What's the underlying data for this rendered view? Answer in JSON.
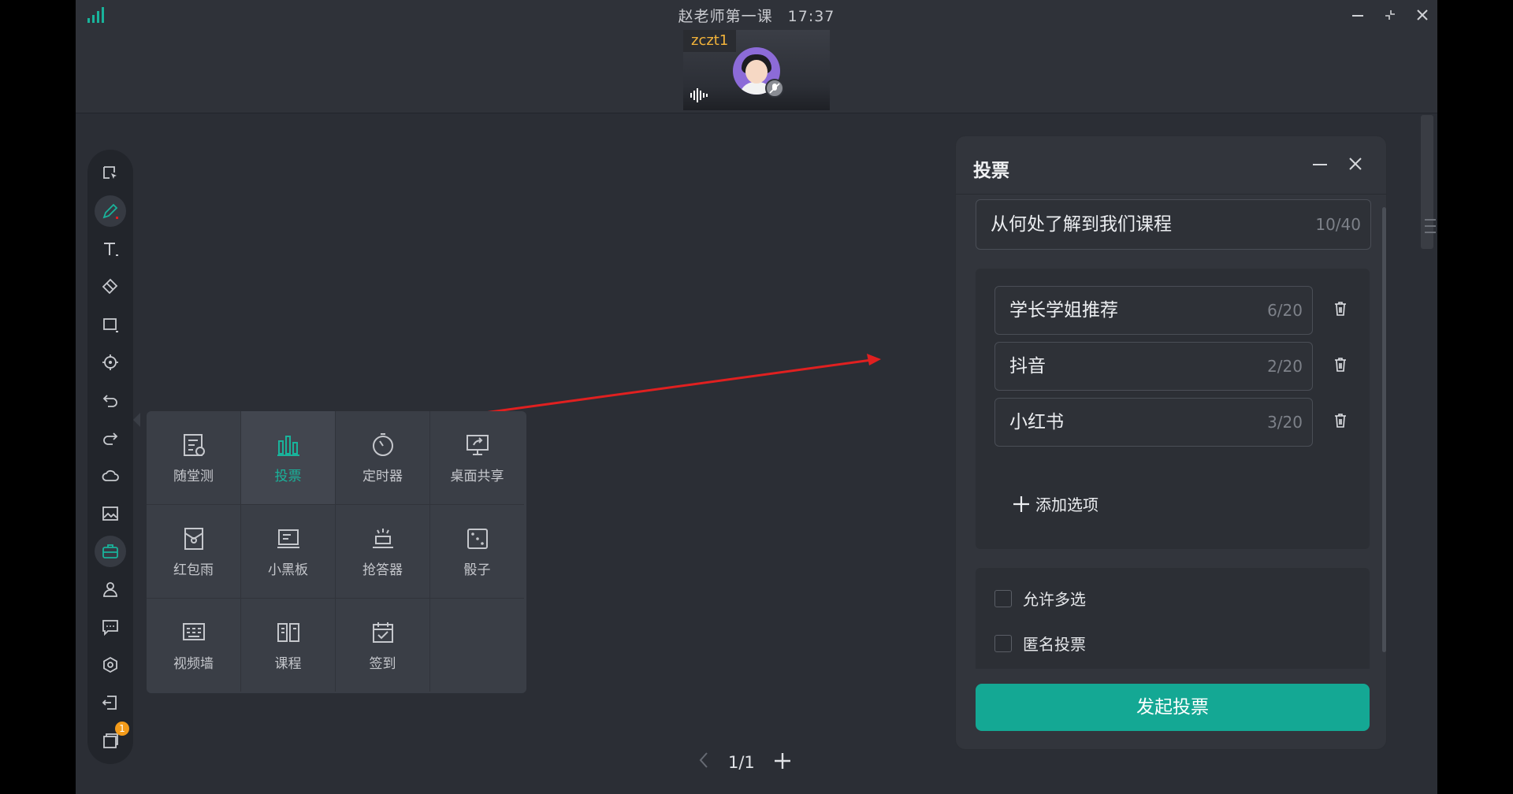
{
  "window": {
    "title": "赵老师第一课",
    "time": "17:37"
  },
  "video_tile": {
    "user_name": "zczt1"
  },
  "colors": {
    "accent": "#14a894",
    "selected_tool": "#19b39b",
    "name_label": "#f2b33a",
    "badge": "#f39b1a",
    "arrow": "#e02020"
  },
  "toolbar": {
    "icons": [
      "select-icon",
      "pen-icon",
      "text-icon",
      "eraser-icon",
      "shape-icon",
      "laser-pointer-icon",
      "undo-icon",
      "redo-icon",
      "cloud-icon",
      "image-icon",
      "toolbox-icon",
      "user-icon",
      "chat-icon",
      "settings-icon",
      "exit-icon",
      "layers-icon"
    ],
    "active": "toolbox-icon",
    "layers_badge": "1"
  },
  "tools_popup": {
    "items": [
      {
        "label": "随堂测",
        "icon": "quiz-icon"
      },
      {
        "label": "投票",
        "icon": "vote-icon",
        "selected": true
      },
      {
        "label": "定时器",
        "icon": "timer-icon"
      },
      {
        "label": "桌面共享",
        "icon": "screen-share-icon"
      },
      {
        "label": "红包雨",
        "icon": "red-packet-icon"
      },
      {
        "label": "小黑板",
        "icon": "blackboard-icon"
      },
      {
        "label": "抢答器",
        "icon": "buzzer-icon"
      },
      {
        "label": "骰子",
        "icon": "dice-icon"
      },
      {
        "label": "视频墙",
        "icon": "video-wall-icon"
      },
      {
        "label": "课程",
        "icon": "course-icon"
      },
      {
        "label": "签到",
        "icon": "check-in-icon"
      }
    ]
  },
  "pager": {
    "page": "1/1"
  },
  "vote_panel": {
    "title": "投票",
    "question": {
      "value": "从何处了解到我们课程",
      "counter": "10/40"
    },
    "options": [
      {
        "value": "学长学姐推荐",
        "counter": "6/20"
      },
      {
        "value": "抖音",
        "counter": "2/20"
      },
      {
        "value": "小红书",
        "counter": "3/20"
      }
    ],
    "add_option_label": "添加选项",
    "allow_multiple_label": "允许多选",
    "allow_multiple": false,
    "anonymous_label": "匿名投票",
    "anonymous": false,
    "submit_label": "发起投票"
  }
}
